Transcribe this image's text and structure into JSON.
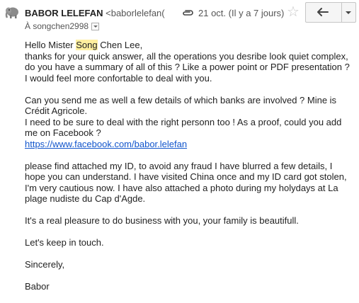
{
  "message": {
    "sender_name": "BABOR LELEFAN",
    "sender_email": "<baborlelefan(",
    "date": "21 oct. (Il y a 7 jours)",
    "recipient": "À songchen2998"
  },
  "icons": {
    "avatar": "gray-elephant-avatar",
    "attachment": "paperclip-icon",
    "star": "star-outline-icon",
    "reply": "reply-arrow-icon",
    "more": "chevron-down-icon"
  },
  "body": {
    "greeting_pre": "Hello Mister ",
    "greeting_highlight": "Song",
    "greeting_post": " Chen Lee,",
    "p1_rest": "thanks for your quick answer, all the operations you desribe look quiet complex, do you have a summary of all of this ? Like a power point or PDF presentation ?",
    "p1_end": "I would feel more confortable to deal with you.",
    "p2_line1": "Can you send me as well a few details of which banks are involved ? Mine is Crédit Agricole.",
    "p2_line2": "I need to be sure to deal with the right personn too ! As a proof, could you add me on Facebook ?",
    "p2_link": "https://www.facebook.com/babor.lelefan",
    "p3": "please find attached my ID, to avoid any fraud I have blurred a few details, I hope you can understand. I have visited China once and my ID card got stolen, I'm very cautious now. I have also attached a photo during my holydays at La plage nudiste du Cap d'Agde.",
    "p4": "It's a real pleasure to do business with you, your family is beautifull.",
    "p5": "Let's keep in touch.",
    "p6": "Sincerely,",
    "signature": "Babor"
  }
}
